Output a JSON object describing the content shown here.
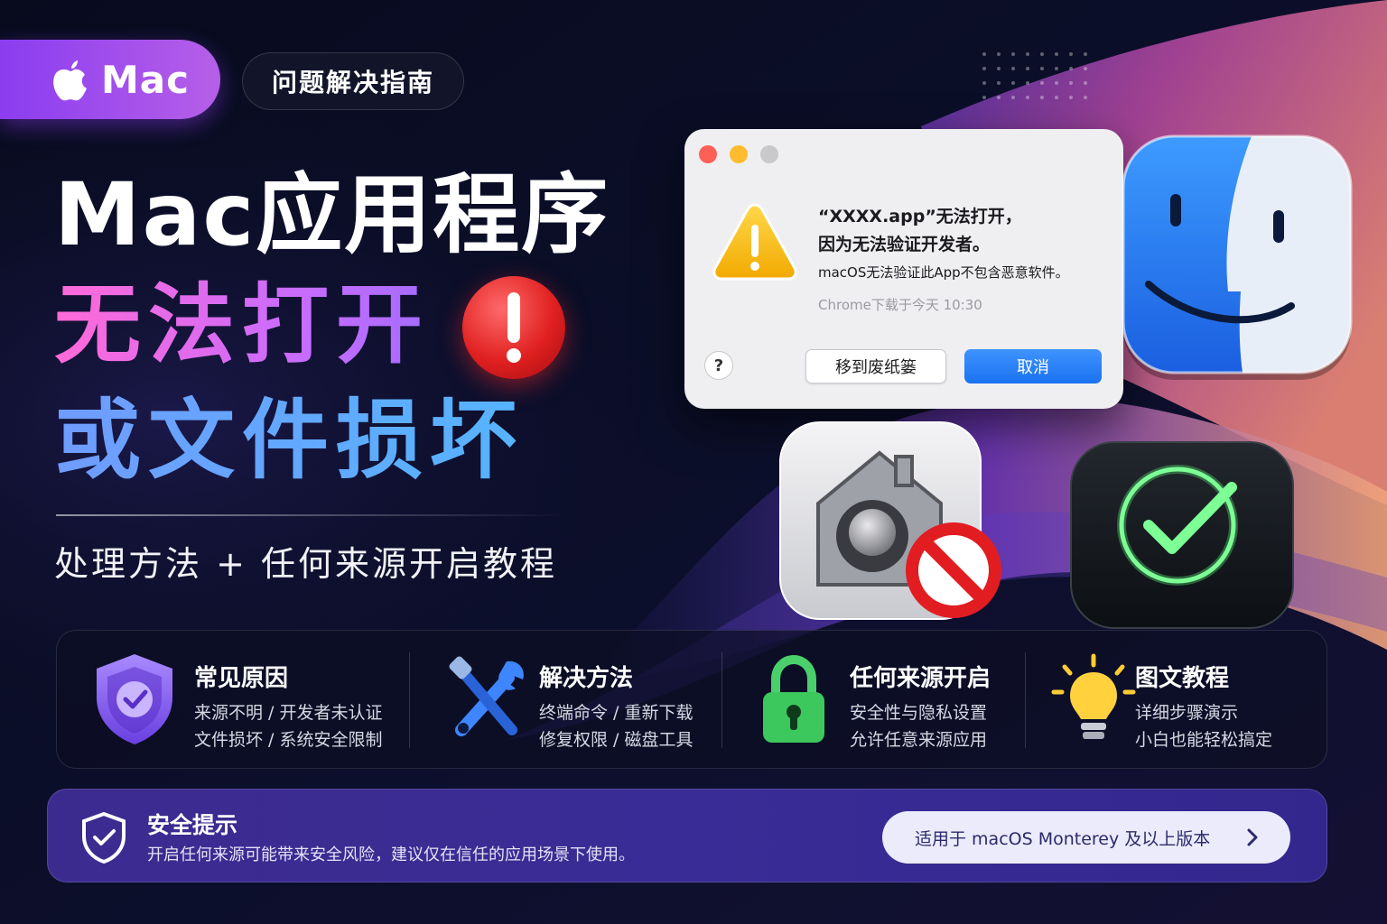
{
  "badges": {
    "mac_label": "Mac",
    "guide_label": "问题解决指南"
  },
  "headline": {
    "line1": "Mac应用程序",
    "line2": "无法打开",
    "line3": "或文件损坏",
    "subtitle": "处理方法 + 任何来源开启教程"
  },
  "dialog": {
    "title_line1": "“XXXX.app”无法打开，",
    "title_line2": "因为无法验证开发者。",
    "body": "macOS无法验证此App不包含恶意软件。",
    "meta": "Chrome下载于今天 10:30",
    "help_label": "?",
    "trash_label": "移到废纸篓",
    "cancel_label": "取消"
  },
  "features": [
    {
      "title": "常见原因",
      "line1": "来源不明 / 开发者未认证",
      "line2": "文件损坏 / 系统安全限制",
      "icon": "shield-check-icon"
    },
    {
      "title": "解决方法",
      "line1": "终端命令 / 重新下载",
      "line2": "修复权限 / 磁盘工具",
      "icon": "wrench-screwdriver-icon"
    },
    {
      "title": "任何来源开启",
      "line1": "安全性与隐私设置",
      "line2": "允许任意来源应用",
      "icon": "padlock-icon"
    },
    {
      "title": "图文教程",
      "line1": "详细步骤演示",
      "line2": "小白也能轻松搞定",
      "icon": "lightbulb-icon"
    }
  ],
  "safety": {
    "title": "安全提示",
    "text": "开启任何来源可能带来安全风险，建议仅在信任的应用场景下使用。",
    "compat_label": "适用于 macOS Monterey 及以上版本"
  },
  "colors": {
    "accent_purple": "#8b3df0",
    "accent_pink": "#ff6ad8",
    "accent_blue": "#56b4ff",
    "alert_red": "#e02020",
    "success_green": "#5cf07a",
    "dialog_blue": "#1a72f0"
  }
}
